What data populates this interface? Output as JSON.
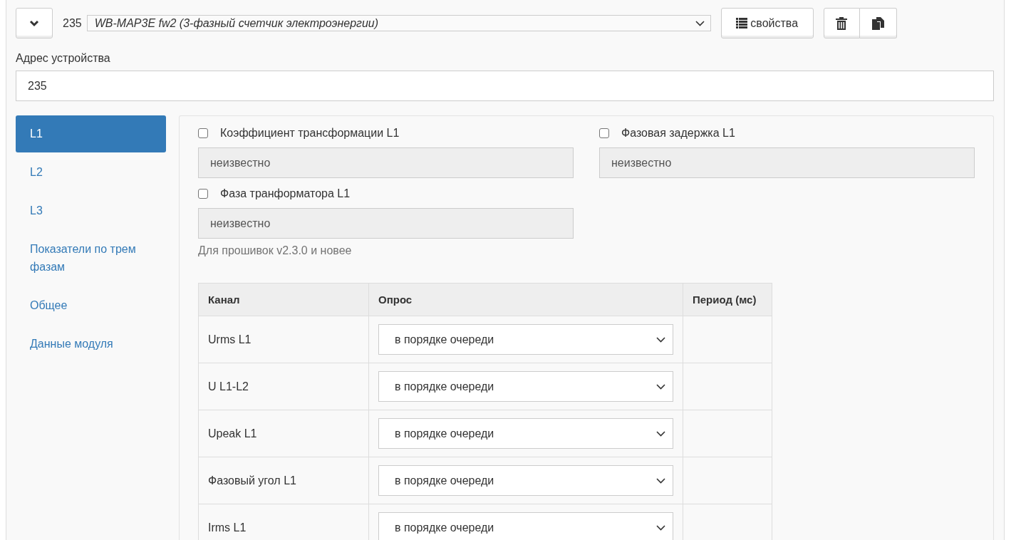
{
  "device": {
    "number": "235",
    "type": "WB-MAP3E fw2 (3-фазный счетчик электроэнергии)",
    "properties_button": "свойства"
  },
  "address": {
    "label": "Адрес устройства",
    "value": "235"
  },
  "tabs": [
    {
      "label": "L1",
      "selected": true
    },
    {
      "label": "L2",
      "selected": false
    },
    {
      "label": "L3",
      "selected": false
    },
    {
      "label": "Показатели по трем фазам",
      "selected": false
    },
    {
      "label": "Общее",
      "selected": false
    },
    {
      "label": "Данные модуля",
      "selected": false
    }
  ],
  "fields": [
    {
      "label": "Коэффициент трансформации L1",
      "checked": false,
      "value": "неизвестно"
    },
    {
      "label": "Фазовая задержка L1",
      "checked": false,
      "value": "неизвестно"
    },
    {
      "label": "Фаза транформатора L1",
      "checked": false,
      "value": "неизвестно",
      "note": "Для прошивок v2.3.0 и новее"
    }
  ],
  "table": {
    "columns": [
      "Канал",
      "Опрос",
      "Период (мс)"
    ],
    "rows": [
      {
        "channel": "Urms L1",
        "poll": "в порядке очереди"
      },
      {
        "channel": "U L1-L2",
        "poll": "в порядке очереди"
      },
      {
        "channel": "Upeak L1",
        "poll": "в порядке очереди"
      },
      {
        "channel": "Фазовый угол L1",
        "poll": "в порядке очереди"
      },
      {
        "channel": "Irms L1",
        "poll": "в порядке очереди"
      }
    ]
  }
}
